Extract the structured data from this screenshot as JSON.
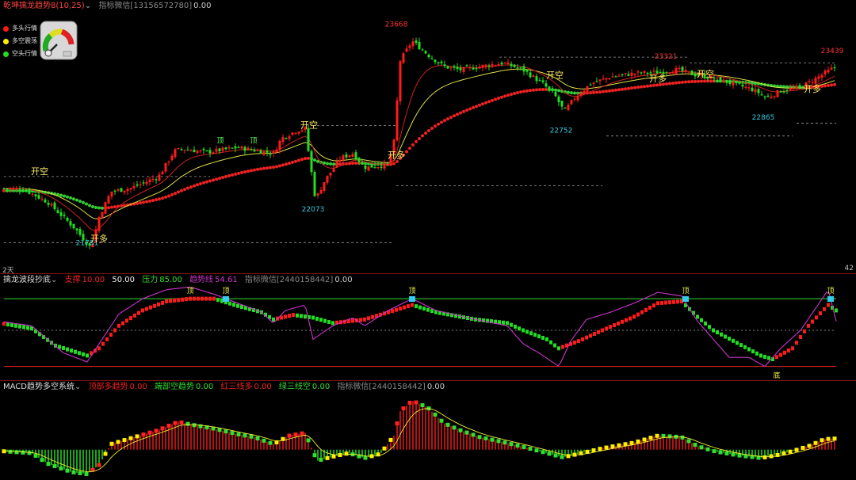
{
  "colors": {
    "up": "#ff1a1a",
    "down": "#22dd22",
    "yellow": "#ffee00",
    "cyan": "#33ccdd",
    "magenta": "#cc33cc",
    "label_red": "#ff3333",
    "gray": "#888888",
    "white": "#ffffff"
  },
  "main_pane": {
    "header": {
      "title": "乾坤擒龙趋势8(10,25)",
      "chevron": "⌄",
      "indicator_label": "指标微信[13156572780]",
      "indicator_value": "0.00"
    },
    "legend": [
      {
        "label": "多头行情",
        "color": "#ff1a1a"
      },
      {
        "label": "多空震荡",
        "color": "#ffee00"
      },
      {
        "label": "空头行情",
        "color": "#22dd22"
      }
    ],
    "gauge": {
      "level": 0.35,
      "icon": "speedometer-gauge-icon"
    },
    "corner_left": "2天",
    "corner_right": "42"
  },
  "wave_pane": {
    "header": {
      "title": "擒龙波段抄底",
      "chevron": "⌄",
      "l1_label": "支撑",
      "l1_value": "10.00",
      "l2_value": "50.00",
      "l3_label": "压力",
      "l3_value": "85.00",
      "l4_label": "趋势线",
      "l4_value": "54.61",
      "indicator_label": "指标微信[2440158442]",
      "indicator_value": "0.00"
    },
    "top_markers": [
      "顶",
      "顶",
      "顶",
      "顶",
      "顶",
      "顶"
    ],
    "bottom_marker": "底"
  },
  "macd_pane": {
    "header": {
      "title": "MACD趋势多空系统",
      "chevron": "⌄",
      "l1_label": "顶部多趋势",
      "l1_value": "0.00",
      "l2_label": "端部空趋势",
      "l2_value": "0.00",
      "l3_label": "红三线多",
      "l3_value": "0.00",
      "l4_label": "绿三线空",
      "l4_value": "0.00",
      "indicator_label": "指标微信[2440158442]",
      "indicator_value": "0.00"
    }
  },
  "chart_data": [
    {
      "type": "candlestick",
      "title": "乾坤擒龙趋势8(10,25)",
      "ylim": [
        21600,
        23800
      ],
      "price_path": [
        [
          0,
          22300
        ],
        [
          30,
          22290
        ],
        [
          60,
          22180
        ],
        [
          95,
          21950
        ],
        [
          115,
          21781
        ],
        [
          125,
          22050
        ],
        [
          140,
          22270
        ],
        [
          165,
          22300
        ],
        [
          200,
          22400
        ],
        [
          220,
          22620
        ],
        [
          230,
          22640
        ],
        [
          260,
          22610
        ],
        [
          300,
          22650
        ],
        [
          345,
          22600
        ],
        [
          355,
          22730
        ],
        [
          375,
          22800
        ],
        [
          385,
          22810
        ],
        [
          398,
          22200
        ],
        [
          410,
          22370
        ],
        [
          430,
          22560
        ],
        [
          445,
          22600
        ],
        [
          460,
          22480
        ],
        [
          490,
          22500
        ],
        [
          497,
          22700
        ],
        [
          505,
          23400
        ],
        [
          520,
          23570
        ],
        [
          540,
          23450
        ],
        [
          560,
          23350
        ],
        [
          580,
          23320
        ],
        [
          605,
          23350
        ],
        [
          635,
          23380
        ],
        [
          660,
          23320
        ],
        [
          685,
          23200
        ],
        [
          700,
          23100
        ],
        [
          712,
          22960
        ],
        [
          725,
          23080
        ],
        [
          745,
          23200
        ],
        [
          770,
          23260
        ],
        [
          800,
          23290
        ],
        [
          830,
          23300
        ],
        [
          855,
          23321
        ],
        [
          875,
          23280
        ],
        [
          900,
          23250
        ],
        [
          925,
          23200
        ],
        [
          950,
          23150
        ],
        [
          968,
          23080
        ],
        [
          985,
          23140
        ],
        [
          1010,
          23170
        ],
        [
          1030,
          23250
        ],
        [
          1055,
          23350
        ]
      ],
      "price_labels": [
        {
          "text": "23668",
          "x": 500,
          "y": 23668
        },
        {
          "text": "23321",
          "x": 840,
          "y": 23390
        },
        {
          "text": "23439",
          "x": 1050,
          "y": 23439
        },
        {
          "text": "22752",
          "x": 708,
          "y": 22752
        },
        {
          "text": "22865",
          "x": 963,
          "y": 22865
        },
        {
          "text": "22073",
          "x": 395,
          "y": 22073
        },
        {
          "text": "21781",
          "x": 110,
          "y": 21781
        }
      ],
      "signals": [
        {
          "text": "开空",
          "x": 50,
          "y": 22420
        },
        {
          "text": "开多",
          "x": 125,
          "y": 21840
        },
        {
          "text": "开空",
          "x": 390,
          "y": 22820
        },
        {
          "text": "开多",
          "x": 500,
          "y": 22560
        },
        {
          "text": "开空",
          "x": 700,
          "y": 23250
        },
        {
          "text": "开多",
          "x": 830,
          "y": 23220
        },
        {
          "text": "开空",
          "x": 890,
          "y": 23260
        },
        {
          "text": "开多",
          "x": 1025,
          "y": 23130
        }
      ],
      "mini_top": [
        {
          "text": "顶",
          "x": 278,
          "y": 22690
        },
        {
          "text": "顶",
          "x": 320,
          "y": 22690
        }
      ],
      "support_lines": [
        {
          "x1": 5,
          "x2": 495,
          "y": 21830
        },
        {
          "x1": 5,
          "x2": 265,
          "y": 22400
        },
        {
          "x1": 400,
          "x2": 500,
          "y": 22840
        },
        {
          "x1": 500,
          "x2": 760,
          "y": 22320
        },
        {
          "x1": 630,
          "x2": 870,
          "y": 23430
        },
        {
          "x1": 765,
          "x2": 1000,
          "y": 22750
        },
        {
          "x1": 870,
          "x2": 1055,
          "y": 23380
        },
        {
          "x1": 1005,
          "x2": 1055,
          "y": 22860
        }
      ]
    },
    {
      "type": "line",
      "title": "擒龙波段抄底",
      "ylim": [
        0,
        100
      ],
      "levels": {
        "support": 10,
        "mid": 50,
        "pressure": 85
      },
      "trend_path": [
        [
          0,
          60
        ],
        [
          40,
          55
        ],
        [
          80,
          25
        ],
        [
          110,
          15
        ],
        [
          125,
          35
        ],
        [
          150,
          68
        ],
        [
          180,
          85
        ],
        [
          210,
          95
        ],
        [
          240,
          98
        ],
        [
          270,
          90
        ],
        [
          300,
          80
        ],
        [
          330,
          70
        ],
        [
          345,
          58
        ],
        [
          360,
          72
        ],
        [
          385,
          78
        ],
        [
          395,
          40
        ],
        [
          420,
          55
        ],
        [
          445,
          64
        ],
        [
          460,
          55
        ],
        [
          490,
          72
        ],
        [
          520,
          85
        ],
        [
          550,
          72
        ],
        [
          600,
          62
        ],
        [
          640,
          55
        ],
        [
          660,
          35
        ],
        [
          680,
          25
        ],
        [
          705,
          10
        ],
        [
          720,
          38
        ],
        [
          740,
          62
        ],
        [
          770,
          70
        ],
        [
          800,
          80
        ],
        [
          830,
          92
        ],
        [
          860,
          88
        ],
        [
          880,
          60
        ],
        [
          900,
          40
        ],
        [
          920,
          20
        ],
        [
          945,
          20
        ],
        [
          965,
          10
        ],
        [
          985,
          30
        ],
        [
          1010,
          50
        ],
        [
          1035,
          82
        ],
        [
          1045,
          95
        ],
        [
          1055,
          60
        ]
      ],
      "wave_path": [
        [
          0,
          58
        ],
        [
          40,
          52
        ],
        [
          70,
          33
        ],
        [
          110,
          22
        ],
        [
          125,
          30
        ],
        [
          150,
          55
        ],
        [
          180,
          72
        ],
        [
          210,
          82
        ],
        [
          240,
          85
        ],
        [
          270,
          85
        ],
        [
          300,
          77
        ],
        [
          330,
          70
        ],
        [
          345,
          62
        ],
        [
          370,
          67
        ],
        [
          395,
          64
        ],
        [
          420,
          58
        ],
        [
          460,
          62
        ],
        [
          490,
          70
        ],
        [
          520,
          78
        ],
        [
          550,
          70
        ],
        [
          600,
          62
        ],
        [
          640,
          58
        ],
        [
          660,
          50
        ],
        [
          690,
          40
        ],
        [
          705,
          30
        ],
        [
          730,
          38
        ],
        [
          760,
          50
        ],
        [
          800,
          65
        ],
        [
          830,
          80
        ],
        [
          860,
          82
        ],
        [
          880,
          65
        ],
        [
          900,
          50
        ],
        [
          930,
          36
        ],
        [
          960,
          22
        ],
        [
          975,
          18
        ],
        [
          1000,
          30
        ],
        [
          1020,
          55
        ],
        [
          1045,
          78
        ],
        [
          1055,
          72
        ]
      ]
    },
    {
      "type": "bar",
      "title": "MACD趋势多空系统",
      "ylim": [
        -40,
        80
      ],
      "hist_path": [
        [
          0,
          -2
        ],
        [
          40,
          -5
        ],
        [
          60,
          -20
        ],
        [
          90,
          -32
        ],
        [
          110,
          -35
        ],
        [
          125,
          -22
        ],
        [
          140,
          8
        ],
        [
          170,
          18
        ],
        [
          200,
          28
        ],
        [
          225,
          40
        ],
        [
          240,
          36
        ],
        [
          270,
          30
        ],
        [
          300,
          22
        ],
        [
          320,
          18
        ],
        [
          345,
          8
        ],
        [
          365,
          20
        ],
        [
          385,
          24
        ],
        [
          400,
          -16
        ],
        [
          420,
          -10
        ],
        [
          440,
          -5
        ],
        [
          460,
          -12
        ],
        [
          480,
          -6
        ],
        [
          497,
          20
        ],
        [
          505,
          55
        ],
        [
          520,
          70
        ],
        [
          540,
          60
        ],
        [
          560,
          38
        ],
        [
          580,
          28
        ],
        [
          605,
          18
        ],
        [
          630,
          12
        ],
        [
          660,
          4
        ],
        [
          690,
          -5
        ],
        [
          710,
          -11
        ],
        [
          730,
          -6
        ],
        [
          760,
          2
        ],
        [
          800,
          10
        ],
        [
          830,
          20
        ],
        [
          860,
          18
        ],
        [
          880,
          5
        ],
        [
          900,
          -2
        ],
        [
          930,
          -8
        ],
        [
          960,
          -12
        ],
        [
          980,
          -8
        ],
        [
          1000,
          -2
        ],
        [
          1020,
          5
        ],
        [
          1040,
          15
        ],
        [
          1055,
          16
        ]
      ]
    }
  ]
}
